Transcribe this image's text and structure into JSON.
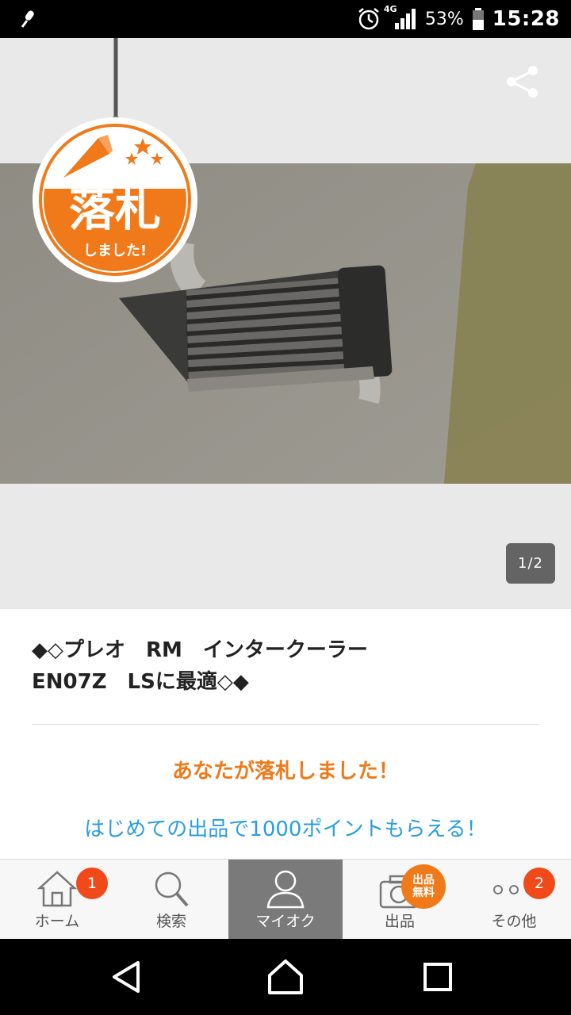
{
  "status_bar": {
    "network": "4G",
    "battery": "53%",
    "time": "15:28"
  },
  "listing": {
    "badge_main": "落札",
    "badge_sub": "しました!",
    "page_indicator": "1/2",
    "title": "◆◇プレオ　RM　インタークーラー\nEN07Z　LSに最適◇◆",
    "won_message": "あなたが落札しました！",
    "promo_message": "はじめての出品で1000ポイントもらえる！"
  },
  "bottom_nav": {
    "home": {
      "label": "ホーム",
      "badge": "1"
    },
    "search": {
      "label": "検索"
    },
    "myauc": {
      "label": "マイオク"
    },
    "sell": {
      "label": "出品",
      "badge": "出品\n無料"
    },
    "other": {
      "label": "その他",
      "badge": "2"
    }
  },
  "colors": {
    "accent_orange": "#f07a1a",
    "promo_blue": "#2a9ee0",
    "badge_red": "#f04a1a"
  }
}
